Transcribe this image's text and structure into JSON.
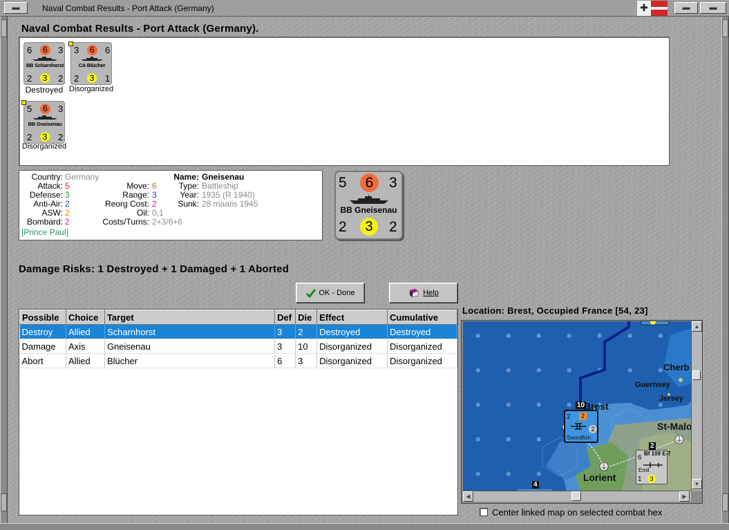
{
  "window": {
    "title": "Naval Combat Results - Port Attack (Germany)",
    "menu_button": "▬",
    "min_button": "▬",
    "close_button": "▬"
  },
  "dialog": {
    "title": "Naval Combat Results - Port Attack (Germany)."
  },
  "units": [
    {
      "name": "BB Scharnhorst",
      "top_left": "6",
      "attack": "6",
      "top_right": "3",
      "bottom_left": "2",
      "move": "3",
      "bottom_right": "2",
      "status": "Destroyed"
    },
    {
      "name": "CA Blücher",
      "top_left": "3",
      "attack": "6",
      "top_right": "6",
      "bottom_left": "2",
      "move": "3",
      "bottom_right": "1",
      "status": "Disorganized"
    },
    {
      "name": "BB Gneisenau",
      "top_left": "5",
      "attack": "6",
      "top_right": "3",
      "bottom_left": "2",
      "move": "3",
      "bottom_right": "2",
      "status": "Disorganized"
    }
  ],
  "info": {
    "labels": {
      "country": "Country:",
      "attack": "Attack:",
      "defense": "Defense:",
      "anti_air": "Anti-Air:",
      "asw": "ASW:",
      "bombard": "Bombard:",
      "move": "Move:",
      "range": "Range:",
      "reorg_cost": "Reorg Cost:",
      "oil": "Oil:",
      "costs_turns": "Costs/Turns:",
      "name": "Name:",
      "type": "Type:",
      "year": "Year:",
      "sunk": "Sunk:"
    },
    "country": "Germany",
    "attack": "5",
    "defense": "3",
    "anti_air": "2",
    "asw": "2",
    "bombard": "2",
    "move": "6",
    "range": "3",
    "reorg_cost": "2",
    "oil": "0,1",
    "costs_turns": "2+3/6+6",
    "name": "Gneisenau",
    "type": "Battleship",
    "year": "1935 (R 1940)",
    "sunk": "28 maalis 1945",
    "prince": "[Prince Paul]"
  },
  "big_counter": {
    "name": "BB Gneisenau",
    "top_left": "5",
    "attack": "6",
    "top_right": "3",
    "bottom_left": "2",
    "move": "3",
    "bottom_right": "2"
  },
  "damage_risks": "Damage Risks:  1 Destroyed + 1 Damaged + 1 Aborted",
  "buttons": {
    "ok": "OK - Done",
    "help": "Help"
  },
  "table": {
    "headers": [
      "Possible",
      "Choice",
      "Target",
      "Def",
      "Die",
      "Effect",
      "Cumulative"
    ],
    "rows": [
      [
        "Destroy",
        "Allied",
        "Scharnhorst",
        "3",
        "2",
        "Destroyed",
        "Destroyed"
      ],
      [
        "Damage",
        "Axis",
        "Gneisenau",
        "3",
        "10",
        "Disorganized",
        "Disorganized"
      ],
      [
        "Abort",
        "Allied",
        "Blücher",
        "6",
        "3",
        "Disorganized",
        "Disorganized"
      ]
    ],
    "selected_row": 0
  },
  "map": {
    "location": "Location:  Brest, Occupied France [54, 23]",
    "places": [
      "Cherb",
      "Guernsey",
      "Jersey",
      "Brest",
      "St-Malo",
      "Lorient"
    ],
    "stack_count_brest": "10",
    "stack_count_east": "2",
    "stack_count_south": "4",
    "air_unit": {
      "name": "Swordfish",
      "top_left": "2",
      "attack": "2",
      "right": "2"
    },
    "ground_unit": {
      "name": "Emil",
      "type": "Bf 109 E-7",
      "top_left": "6",
      "bottom_left": "1",
      "move": "3"
    },
    "colors": {
      "sea": "#1f5fb0",
      "land": "#4a8fd4",
      "route": "#0a1e8c"
    }
  },
  "center_linked_label": "Center linked map on selected combat hex"
}
